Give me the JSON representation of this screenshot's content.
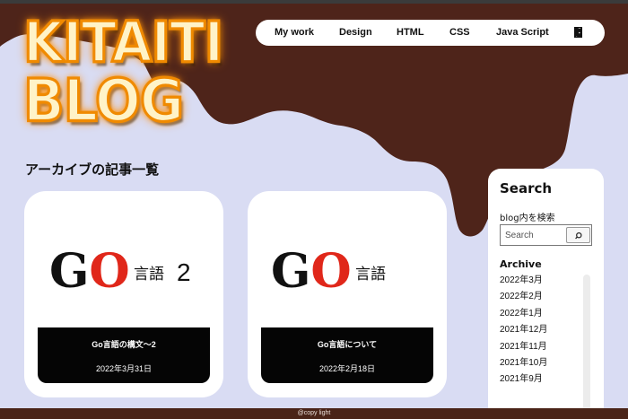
{
  "logo": {
    "line1": "KITAITI",
    "line2": "BLOG"
  },
  "nav": {
    "items": [
      {
        "label": "My work"
      },
      {
        "label": "Design"
      },
      {
        "label": "HTML"
      },
      {
        "label": "CSS"
      },
      {
        "label": "Java Script"
      }
    ],
    "icon": "door-icon"
  },
  "main": {
    "heading": "アーカイブの記事一覧",
    "cards": [
      {
        "thumb_g": "G",
        "thumb_o": "O",
        "thumb_sub": "言語",
        "thumb_num": "2",
        "title": "Go言語の構文〜2",
        "date": "2022年3月31日"
      },
      {
        "thumb_g": "G",
        "thumb_o": "O",
        "thumb_sub": "言語",
        "title": "Go言語について",
        "date": "2022年2月18日"
      }
    ]
  },
  "sidebar": {
    "title": "Search",
    "search_label": "blog内を検索",
    "search_placeholder": "Search",
    "archive_title": "Archive",
    "archive_items": [
      "2022年3月",
      "2022年2月",
      "2022年1月",
      "2021年12月",
      "2021年11月",
      "2021年10月",
      "2021年9月"
    ]
  },
  "footer": {
    "text": "@copy light"
  },
  "colors": {
    "chocolate": "#4e241a",
    "background": "#d9dcf3",
    "accent_red": "#e0271a",
    "logo_orange": "#f08a00"
  }
}
